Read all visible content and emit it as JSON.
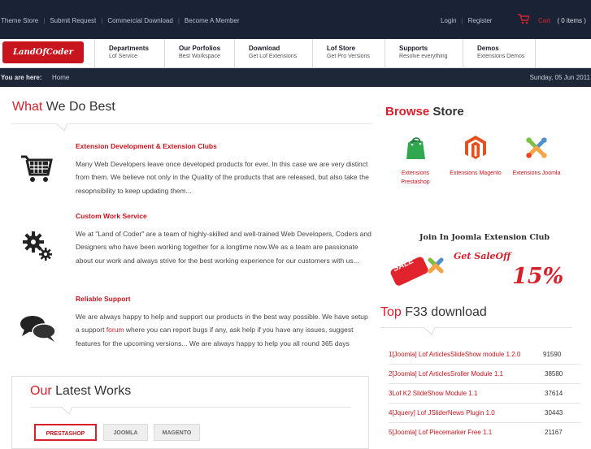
{
  "topbar": {
    "links": [
      "Theme Store",
      "Submit Request",
      "Commercial Download",
      "Become A Member"
    ],
    "login": "Login",
    "register": "Register",
    "cart_label": "Cart",
    "cart_count": "( 0 items )"
  },
  "nav": {
    "logo": "LandOfCoder",
    "items": [
      {
        "title": "Departments",
        "sub": "Lof Service"
      },
      {
        "title": "Our Porfolios",
        "sub": "Best Workspace"
      },
      {
        "title": "Download",
        "sub": "Get Lof Extensions"
      },
      {
        "title": "Lof Store",
        "sub": "Get Pro Versions"
      },
      {
        "title": "Supports",
        "sub": "Resolve everything"
      },
      {
        "title": "Demos",
        "sub": "Extensions Demos"
      }
    ]
  },
  "breadcrumb": {
    "label": "You are here:",
    "home": "Home",
    "date": "Sunday, 05 Jun 2011"
  },
  "what": {
    "title_accent": "What",
    "title_rest": " We Do Best",
    "services": [
      {
        "title": "Extension Development & Extension Clubs",
        "desc": "Many Web Developers leave once developed products for ever. In this case we are very distinct from them. We believe not only in the Quality of the products that are released, but also take the resopnsibility to keep updating them..."
      },
      {
        "title": "Custom Work Service",
        "desc": "We at \"Land of Coder\" are a team of  highly-skilled and well-trained Web Developers, Coders and Designers who have been working together for a longtime now.We as a team are passionate about our work and always strive for the best working experience for our customers with us..."
      },
      {
        "title": "Reliable Support",
        "desc_before": "We are always happy to help and support our products in the best way possible. We have setup a support ",
        "desc_link": "forum",
        "desc_after": " where you can report bugs if any, ask help if you have any issues, suggest features for the upcoming versions... We are always happy to help you all round 365 days"
      }
    ]
  },
  "works": {
    "title_accent": "Our",
    "title_rest": " Latest Works",
    "tabs": [
      "PRESTASHOP",
      "JOOMLA",
      "MAGENTO"
    ]
  },
  "browse": {
    "title_accent": "Browse",
    "title_rest": " Store",
    "items": [
      {
        "label_line1": "Extensions",
        "label_line2": "Prestashop",
        "icon": "shopping-bag-icon"
      },
      {
        "label_line1": "Extensions Magento",
        "label_line2": "",
        "icon": "magento-icon"
      },
      {
        "label_line1": "Extensions Joomla",
        "label_line2": "",
        "icon": "joomla-icon"
      }
    ]
  },
  "promo": {
    "join_text": "Join In Joomla Extension Club",
    "sale_badge": "SALE",
    "get_sale_off": "Get SaleOff",
    "percent": "15%"
  },
  "topdl": {
    "title_accent": "Top",
    "title_rest": " F33 download",
    "rows": [
      {
        "name": "1[Joomla] Lof ArticlesSlideShow module 1.2.0",
        "count": "91590"
      },
      {
        "name": "2[Joomla] Lof ArticlesSroller Module 1.1",
        "count": "38580"
      },
      {
        "name": "3Lof K2 SlideShow Module 1.1",
        "count": "37614"
      },
      {
        "name": "4[Jquery] Lof JSliderNews Plugin 1.0",
        "count": "30443"
      },
      {
        "name": "5[Joomla] Lof Piecemarker Free 1.1",
        "count": "21167"
      }
    ]
  },
  "colors": {
    "accent": "#d8202c",
    "dark": "#1a2336",
    "crumb": "#1d2738"
  }
}
